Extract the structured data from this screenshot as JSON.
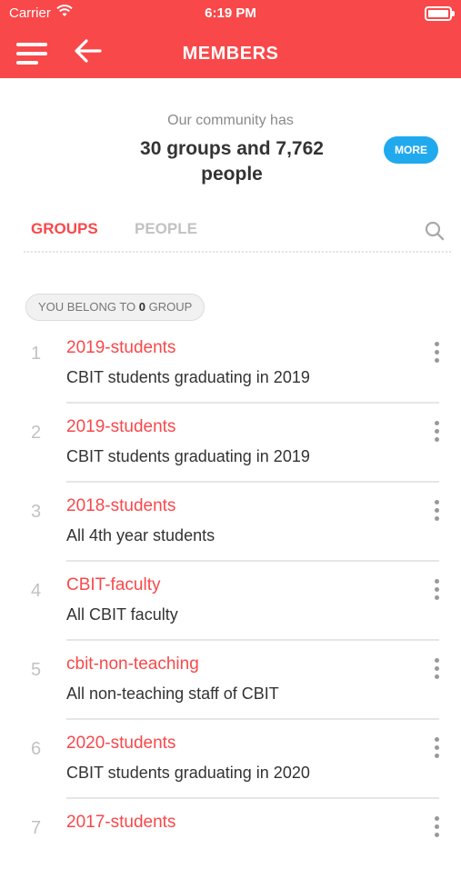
{
  "status_bar": {
    "carrier": "Carrier",
    "time": "6:19 PM"
  },
  "nav": {
    "title": "MEMBERS",
    "menu_icon": "hamburger-menu-icon",
    "back_icon": "arrow-left-icon"
  },
  "summary": {
    "subtitle": "Our community has",
    "headline": "30 groups and 7,762 people",
    "more_label": "MORE"
  },
  "tabs": {
    "groups_label": "GROUPS",
    "people_label": "PEOPLE",
    "search_icon": "search-icon",
    "active": "GROUPS"
  },
  "belong": {
    "prefix": "YOU BELONG TO",
    "count": "0",
    "suffix": "GROUP"
  },
  "groups": [
    {
      "number": "1",
      "name": "2019-students",
      "description": "CBIT students graduating in 2019"
    },
    {
      "number": "2",
      "name": "2019-students",
      "description": "CBIT students graduating in 2019"
    },
    {
      "number": "3",
      "name": "2018-students",
      "description": "All 4th year students"
    },
    {
      "number": "4",
      "name": "CBIT-faculty",
      "description": "All CBIT faculty"
    },
    {
      "number": "5",
      "name": "cbit-non-teaching",
      "description": "All non-teaching staff of CBIT"
    },
    {
      "number": "6",
      "name": "2020-students",
      "description": "CBIT students graduating in 2020"
    },
    {
      "number": "7",
      "name": "2017-students",
      "description": ""
    }
  ],
  "colors": {
    "brand": "#f9484a",
    "accent": "#21a9ee"
  }
}
